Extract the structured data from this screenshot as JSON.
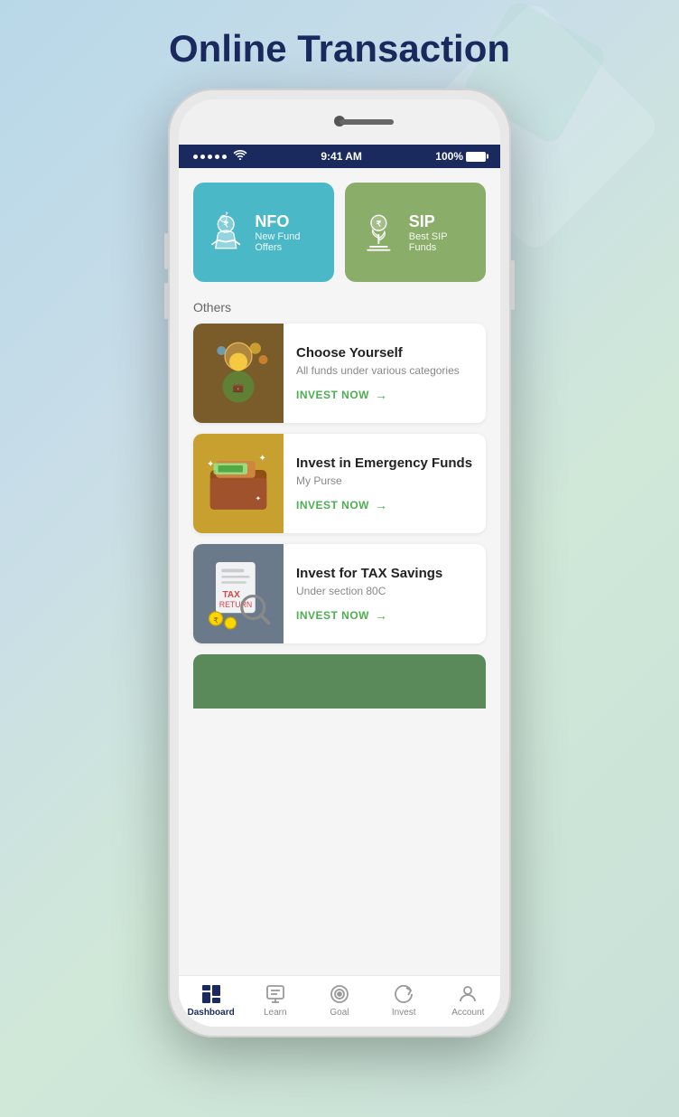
{
  "page": {
    "title": "Online Transaction",
    "bg_colors": [
      "#b8d8e8",
      "#c8dde8",
      "#d0e8d8",
      "#c8e0d8"
    ]
  },
  "status_bar": {
    "time": "9:41 AM",
    "battery": "100%",
    "signal_dots": 5
  },
  "fund_cards": [
    {
      "id": "nfo",
      "title": "NFO",
      "subtitle": "New Fund Offers",
      "bg_color": "#4bb8c8"
    },
    {
      "id": "sip",
      "title": "SIP",
      "subtitle": "Best SIP Funds",
      "bg_color": "#8bad6a"
    }
  ],
  "others_section": {
    "label": "Others",
    "items": [
      {
        "id": "choose-yourself",
        "title": "Choose Yourself",
        "subtitle": "All funds under various categories",
        "invest_label": "INVEST NOW",
        "image_bg": "#7a5c2a"
      },
      {
        "id": "emergency-funds",
        "title": "Invest in Emergency Funds",
        "subtitle": "My Purse",
        "invest_label": "INVEST NOW",
        "image_bg": "#c8a030"
      },
      {
        "id": "tax-savings",
        "title": "Invest for TAX Savings",
        "subtitle": "Under section 80C",
        "invest_label": "INVEST NOW",
        "image_bg": "#6a7a8a"
      }
    ]
  },
  "bottom_nav": {
    "items": [
      {
        "id": "dashboard",
        "label": "Dashboard",
        "active": true
      },
      {
        "id": "learn",
        "label": "Learn",
        "active": false
      },
      {
        "id": "goal",
        "label": "Goal",
        "active": false
      },
      {
        "id": "invest",
        "label": "Invest",
        "active": false
      },
      {
        "id": "account",
        "label": "Account",
        "active": false
      }
    ]
  }
}
